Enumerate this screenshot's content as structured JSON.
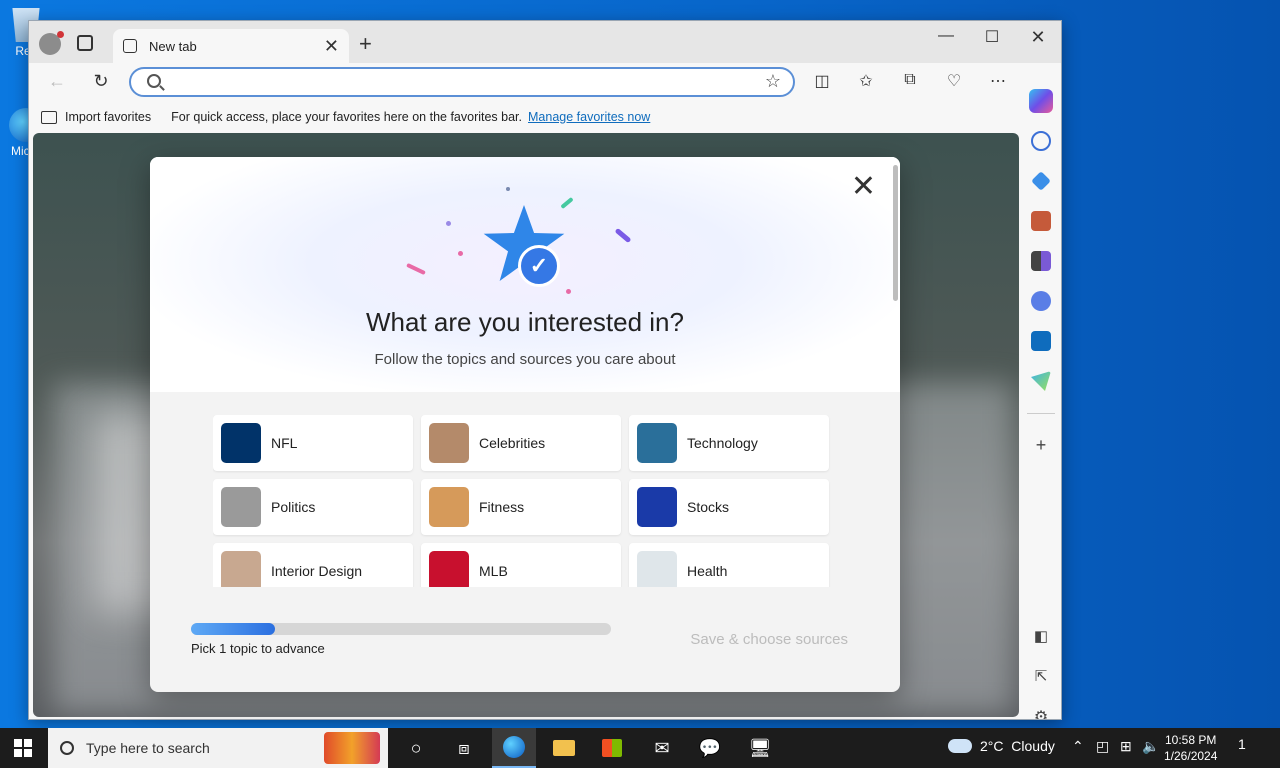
{
  "desktop": {
    "icons": [
      {
        "label": "Rec"
      },
      {
        "label": "Mic E"
      }
    ]
  },
  "browser": {
    "tab": {
      "title": "New tab"
    },
    "address": {
      "value": "",
      "placeholder": ""
    },
    "favorites_bar": {
      "import_label": "Import favorites",
      "message": "For quick access, place your favorites here on the favorites bar.",
      "manage_link": "Manage favorites now"
    }
  },
  "modal": {
    "heading": "What are you interested in?",
    "subheading": "Follow the topics and sources you care about",
    "topics": [
      {
        "label": "NFL",
        "color": "#013369"
      },
      {
        "label": "Celebrities",
        "color": "#b48a6a"
      },
      {
        "label": "Technology",
        "color": "#2a6f9a"
      },
      {
        "label": "Politics",
        "color": "#9a9a9a"
      },
      {
        "label": "Fitness",
        "color": "#d69a5a"
      },
      {
        "label": "Stocks",
        "color": "#1a3aa8"
      },
      {
        "label": "Interior Design",
        "color": "#c8a890"
      },
      {
        "label": "MLB",
        "color": "#c8102e"
      },
      {
        "label": "Health",
        "color": "#dfe6ea"
      }
    ],
    "progress": {
      "value": 0.2
    },
    "pick_label": "Pick 1 topic to advance",
    "save_label": "Save & choose sources"
  },
  "taskbar": {
    "search_placeholder": "Type here to search",
    "weather": {
      "temp": "2°C",
      "condition": "Cloudy"
    },
    "clock": {
      "time": "10:58 PM",
      "date": "1/26/2024"
    },
    "notification_count": "1"
  },
  "colors": {
    "accent": "#0f6cbd",
    "progress_start": "#5ea9f5",
    "progress_end": "#2b6fe0"
  }
}
